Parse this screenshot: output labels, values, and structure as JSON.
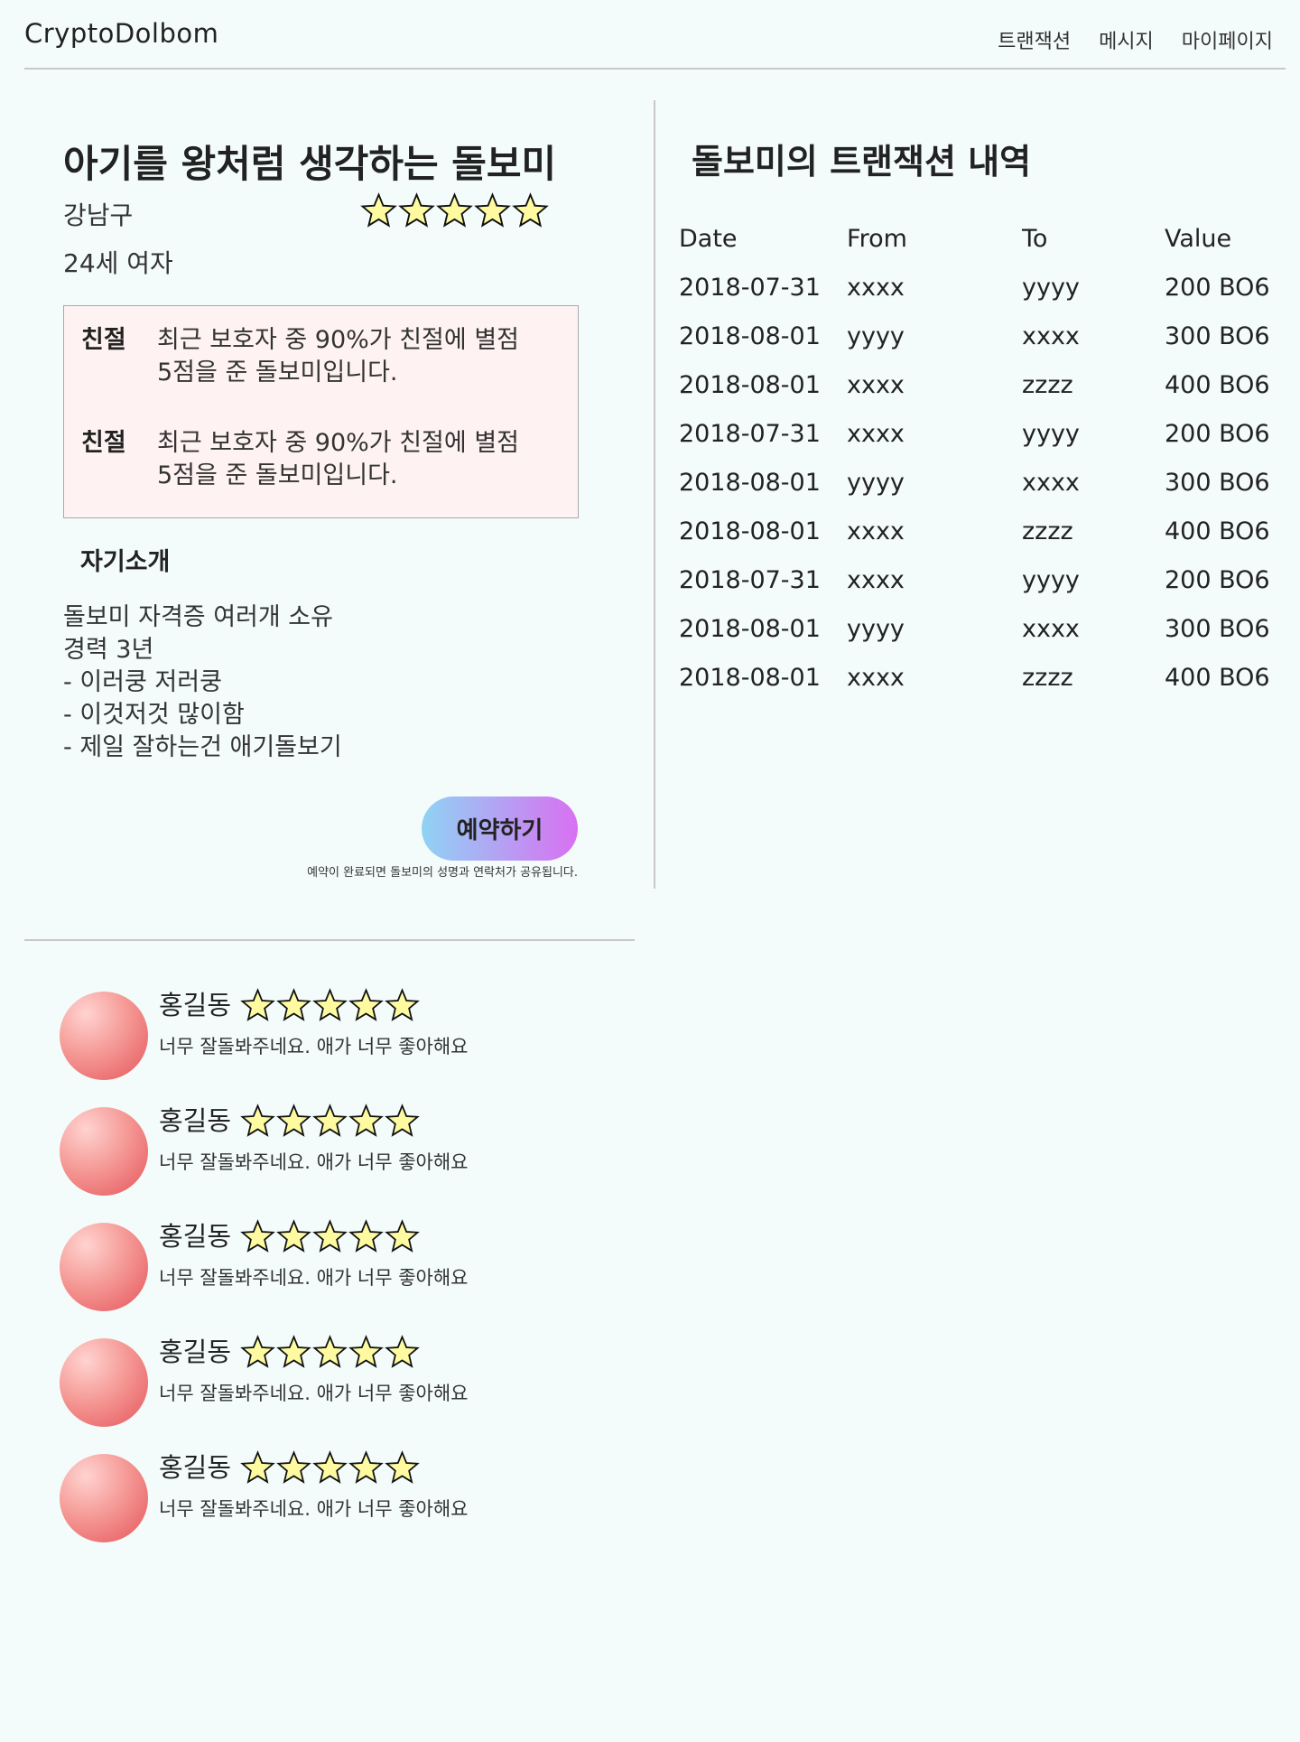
{
  "header": {
    "logo": "CryptoDolbom",
    "nav": [
      "트랜잭션",
      "메시지",
      "마이페이지"
    ]
  },
  "colors": {
    "background": "#f3fcfb",
    "star_fill": "#fdfa9f",
    "badge_box": "#fef3f2",
    "button_gradient_start": "#8fd3f4",
    "button_gradient_end": "#d970f2",
    "avatar": "#e5545a"
  },
  "profile": {
    "title": "아기를 왕처럼 생각하는 돌보미",
    "location": "강남구",
    "age_gender": "24세 여자",
    "rating": 5,
    "badges": [
      {
        "label": "친절",
        "text": "최근 보호자 중 90%가 친절에 별점\n5점을 준 돌보미입니다."
      },
      {
        "label": "친절",
        "text": "최근 보호자 중 90%가 친절에 별점\n5점을 준 돌보미입니다."
      }
    ],
    "intro_heading": "자기소개",
    "intro_text": "돌보미 자격증 여러개 소유\n경력 3년\n- 이러쿵 저러쿵\n- 이것저것 많이함\n- 제일 잘하는건 애기돌보기",
    "reserve_button": "예약하기",
    "reserve_note": "예약이 완료되면 돌보미의 성명과 연락처가 공유됩니다."
  },
  "transactions": {
    "title": "돌보미의 트랜잭션 내역",
    "columns": [
      "Date",
      "From",
      "To",
      "Value"
    ],
    "rows": [
      [
        "2018-07-31",
        "xxxx",
        "yyyy",
        "200 BO6"
      ],
      [
        "2018-08-01",
        "yyyy",
        "xxxx",
        "300 BO6"
      ],
      [
        "2018-08-01",
        "xxxx",
        "zzzz",
        "400 BO6"
      ],
      [
        "2018-07-31",
        "xxxx",
        "yyyy",
        "200 BO6"
      ],
      [
        "2018-08-01",
        "yyyy",
        "xxxx",
        "300 BO6"
      ],
      [
        "2018-08-01",
        "xxxx",
        "zzzz",
        "400 BO6"
      ],
      [
        "2018-07-31",
        "xxxx",
        "yyyy",
        "200 BO6"
      ],
      [
        "2018-08-01",
        "yyyy",
        "xxxx",
        "300 BO6"
      ],
      [
        "2018-08-01",
        "xxxx",
        "zzzz",
        "400 BO6"
      ]
    ]
  },
  "reviews": [
    {
      "name": "홍길동",
      "rating": 5,
      "text": "너무 잘돌봐주네요. 애가 너무 좋아해요",
      "avatar_icon": "user-avatar-icon"
    },
    {
      "name": "홍길동",
      "rating": 5,
      "text": "너무 잘돌봐주네요. 애가 너무 좋아해요",
      "avatar_icon": "user-avatar-icon"
    },
    {
      "name": "홍길동",
      "rating": 5,
      "text": "너무 잘돌봐주네요. 애가 너무 좋아해요",
      "avatar_icon": "user-avatar-icon"
    },
    {
      "name": "홍길동",
      "rating": 5,
      "text": "너무 잘돌봐주네요. 애가 너무 좋아해요",
      "avatar_icon": "user-avatar-icon"
    },
    {
      "name": "홍길동",
      "rating": 5,
      "text": "너무 잘돌봐주네요. 애가 너무 좋아해요",
      "avatar_icon": "user-avatar-icon"
    }
  ]
}
